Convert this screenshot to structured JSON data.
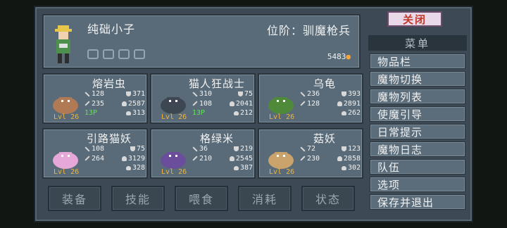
{
  "player": {
    "name": "纯础小子",
    "rank": "位阶：驯魔枪兵",
    "gold": "5483",
    "gold_icon": "coin-icon"
  },
  "party_icon": "ᛉᛁ",
  "monsters": [
    {
      "name": "熔岩虫",
      "level": "Lvl 26",
      "atk": "128",
      "def": "371",
      "matk": "235",
      "hp": "2587",
      "sp": "13P",
      "spd": "313",
      "sprite_color": "#b07a55"
    },
    {
      "name": "猫人狂战士",
      "level": "Lvl 26",
      "atk": "310",
      "def": "75",
      "matk": "108",
      "hp": "2041",
      "sp": "13P",
      "spd": "212",
      "sprite_color": "#3d4752"
    },
    {
      "name": "乌龟",
      "level": "Lvl 26",
      "atk": "236",
      "def": "393",
      "matk": "128",
      "hp": "2891",
      "sp": "",
      "spd": "262",
      "sprite_color": "#4f8a3a"
    },
    {
      "name": "引路猫妖",
      "level": "Lvl 26",
      "atk": "108",
      "def": "75",
      "matk": "264",
      "hp": "3129",
      "sp": "",
      "spd": "328",
      "sprite_color": "#e6a8d8"
    },
    {
      "name": "格绿米",
      "level": "Lvl 26",
      "atk": "36",
      "def": "219",
      "matk": "210",
      "hp": "2545",
      "sp": "",
      "spd": "387",
      "sprite_color": "#6b4e9b"
    },
    {
      "name": "菇妖",
      "level": "Lvl 26",
      "atk": "72",
      "def": "123",
      "matk": "230",
      "hp": "2858",
      "sp": "",
      "spd": "302",
      "sprite_color": "#c9a36b"
    }
  ],
  "tabs": [
    "装备",
    "技能",
    "喂食",
    "消耗",
    "状态"
  ],
  "close_label": "关闭",
  "menu_header": "菜单",
  "menu_items": [
    "物品栏",
    "魔物切换",
    "魔物列表",
    "使魔引导",
    "日常提示",
    "魔物日志",
    "队伍",
    "选项",
    "保存并退出"
  ]
}
